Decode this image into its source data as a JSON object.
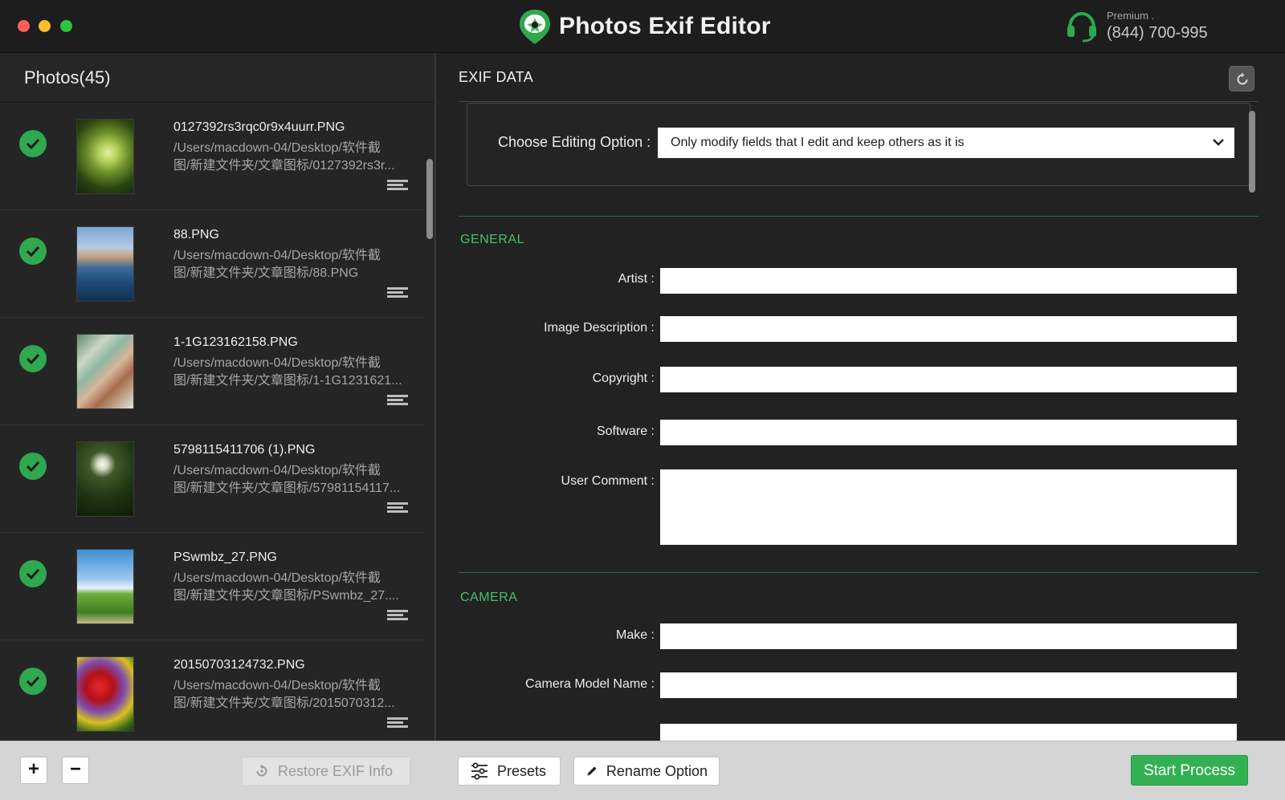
{
  "window": {
    "app_title": "Photos Exif Editor",
    "support_label": "Premium .",
    "support_phone": "(844) 700-995"
  },
  "left_panel": {
    "header": "Photos(45)",
    "photos": [
      {
        "name": "0127392rs3rqc0r9x4uurr.PNG",
        "path_line1": "/Users/macdown-04/Desktop/软件截",
        "path_line2": "图/新建文件夹/文章图标/0127392rs3r...",
        "status": "checked",
        "thumb": "forest-path"
      },
      {
        "name": "88.PNG",
        "path_line1": "/Users/macdown-04/Desktop/软件截",
        "path_line2": "图/新建文件夹/文章图标/88.PNG",
        "status": "checked",
        "thumb": "sea-tower"
      },
      {
        "name": "1-1G123162158.PNG",
        "path_line1": "/Users/macdown-04/Desktop/软件截",
        "path_line2": "图/新建文件夹/文章图标/1-1G1231621...",
        "status": "checked",
        "thumb": "anime-girl"
      },
      {
        "name": "5798115411706 (1).PNG",
        "path_line1": "/Users/macdown-04/Desktop/软件截",
        "path_line2": "图/新建文件夹/文章图标/57981154117...",
        "status": "checked",
        "thumb": "flower-dark"
      },
      {
        "name": "PSwmbz_27.PNG",
        "path_line1": "/Users/macdown-04/Desktop/软件截",
        "path_line2": "图/新建文件夹/文章图标/PSwmbz_27....",
        "status": "checked",
        "thumb": "windmill-field"
      },
      {
        "name": "20150703124732.PNG",
        "path_line1": "/Users/macdown-04/Desktop/软件截",
        "path_line2": "图/新建文件夹/文章图标/2015070312...",
        "status": "checked",
        "thumb": "red-poppies"
      }
    ]
  },
  "right_panel": {
    "title": "EXIF DATA",
    "editing_option_label": "Choose Editing Option :",
    "editing_option_value": "Only modify fields that I edit and keep others as it is",
    "general": {
      "title": "GENERAL",
      "fields": [
        {
          "label": "Artist :",
          "value": ""
        },
        {
          "label": "Image Description :",
          "value": ""
        },
        {
          "label": "Copyright :",
          "value": ""
        },
        {
          "label": "Software :",
          "value": ""
        },
        {
          "label": "User Comment :",
          "value": ""
        }
      ]
    },
    "camera": {
      "title": "CAMERA",
      "fields": [
        {
          "label": "Make :",
          "value": ""
        },
        {
          "label": "Camera Model Name :",
          "value": ""
        }
      ]
    }
  },
  "bottom_bar": {
    "add_label": "+",
    "remove_label": "−",
    "restore_label": "Restore EXIF Info",
    "presets_label": "Presets",
    "rename_label": "Rename Option",
    "start_label": "Start Process"
  },
  "colors": {
    "accent_green": "#32b152",
    "section_green": "#45c266",
    "background": "#222223"
  }
}
